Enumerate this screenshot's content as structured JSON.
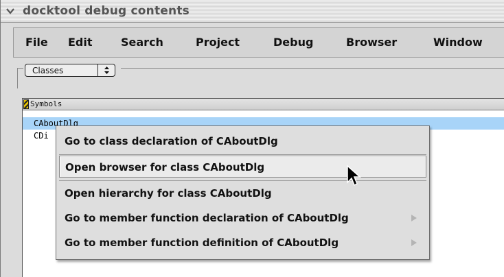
{
  "window": {
    "title": "docktool debug contents"
  },
  "menubar": {
    "items": [
      "File",
      "Edit",
      "Search",
      "Project",
      "Debug",
      "Browser",
      "Window"
    ]
  },
  "popup": {
    "selected": "Classes",
    "arrows_icon": "up-down-arrows-icon"
  },
  "table": {
    "header": "Symbols",
    "rows": [
      "CAboutDlg",
      "CDi"
    ]
  },
  "context_menu": {
    "items": [
      {
        "label": "Go to class declaration of CAboutDlg",
        "submenu": false
      },
      {
        "label": "Open browser for class CAboutDlg",
        "submenu": false
      },
      {
        "label": "Open hierarchy for class CAboutDlg",
        "submenu": false
      },
      {
        "label": "Go to member function declaration of CAboutDlg",
        "submenu": true
      },
      {
        "label": "Go to member function definition of CAboutDlg",
        "submenu": true
      }
    ]
  },
  "colors": {
    "selection": "#a8d4f8",
    "menu_background": "#dedede"
  }
}
